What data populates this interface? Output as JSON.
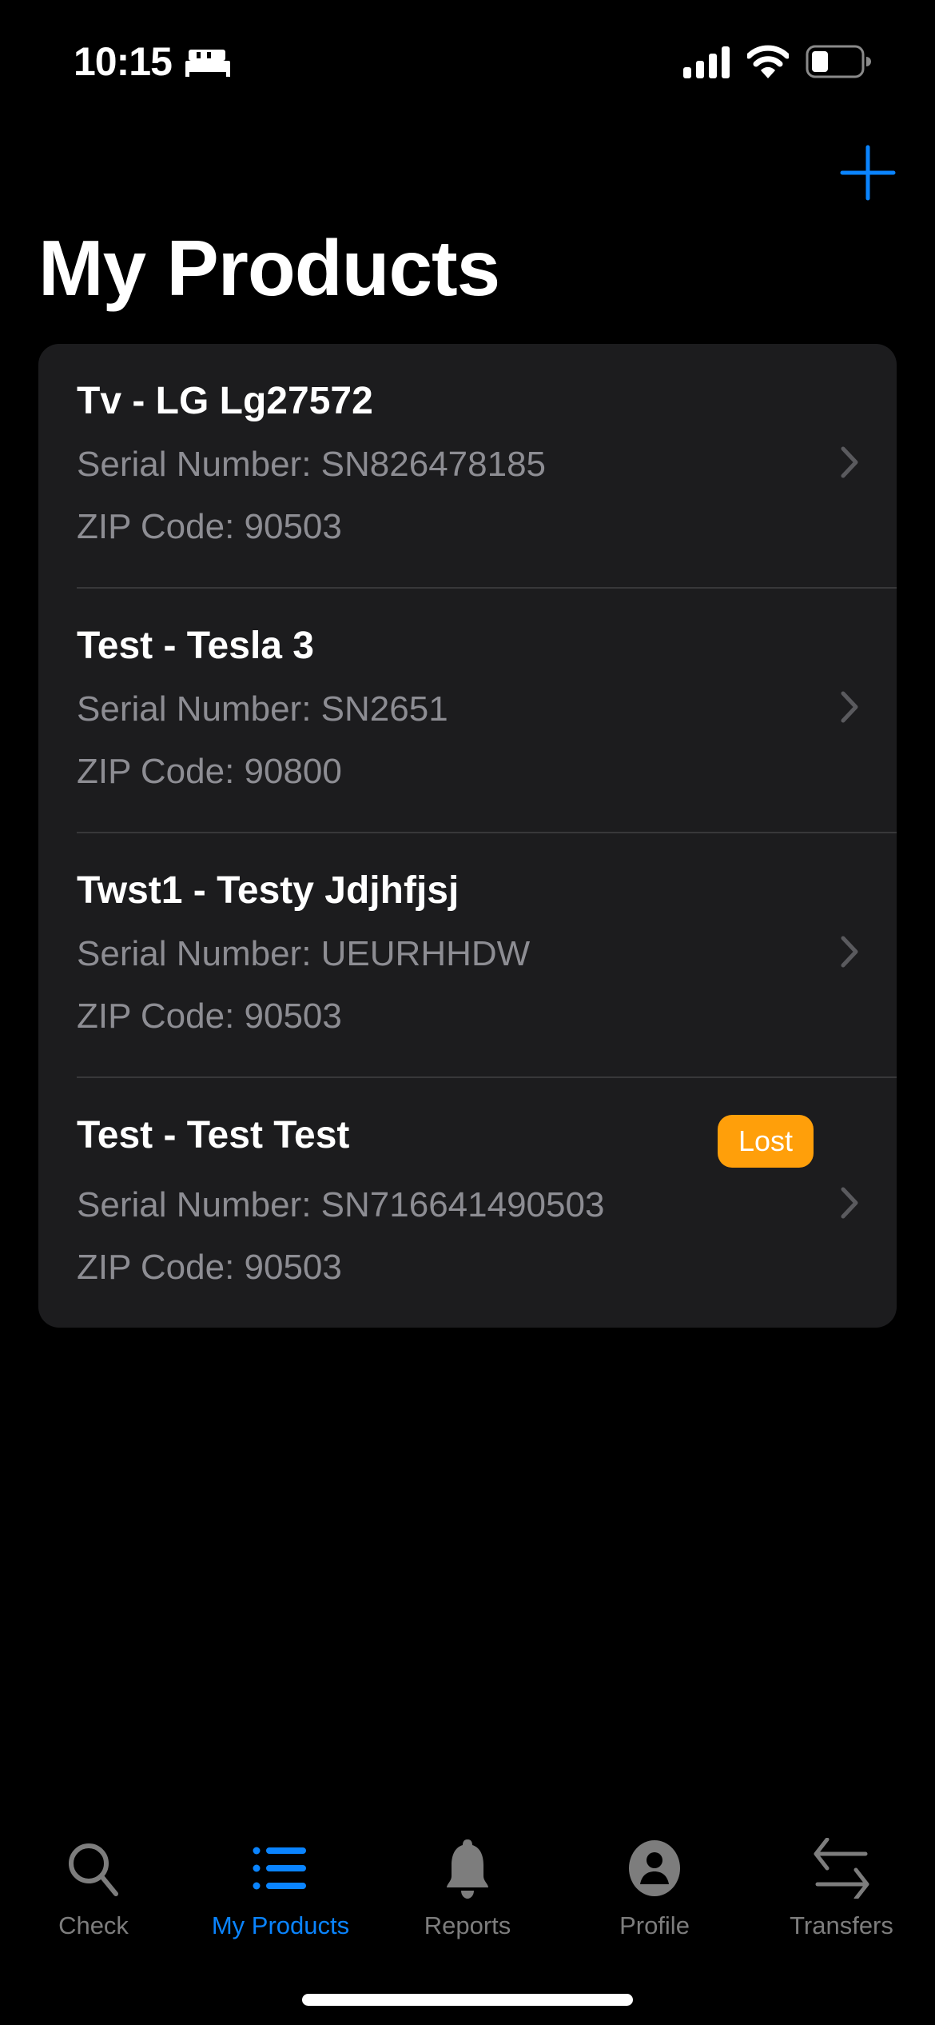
{
  "status_bar": {
    "time": "10:15",
    "focus_icon": "bed-icon",
    "signal_icon": "cellular-signal-icon",
    "wifi_icon": "wifi-icon",
    "battery_icon": "battery-icon"
  },
  "header": {
    "title": "My Products",
    "add_icon": "plus-icon"
  },
  "products": [
    {
      "name": "Tv - LG Lg27572",
      "serial": "Serial Number: SN826478185",
      "zip": "ZIP Code: 90503",
      "badge": null
    },
    {
      "name": "Test - Tesla 3",
      "serial": "Serial Number: SN2651",
      "zip": "ZIP Code: 90800",
      "badge": null
    },
    {
      "name": "Twst1 - Testy Jdjhfjsj",
      "serial": "Serial Number: UEURHHDW",
      "zip": "ZIP Code: 90503",
      "badge": null
    },
    {
      "name": "Test - Test Test",
      "serial": "Serial Number: SN716641490503",
      "zip": "ZIP Code: 90503",
      "badge": "Lost"
    }
  ],
  "tab_bar": {
    "tabs": [
      {
        "label": "Check",
        "icon": "magnifying-glass-icon",
        "active": false
      },
      {
        "label": "My Products",
        "icon": "list-icon",
        "active": true
      },
      {
        "label": "Reports",
        "icon": "bell-icon",
        "active": false
      },
      {
        "label": "Profile",
        "icon": "person-circle-icon",
        "active": false
      },
      {
        "label": "Transfers",
        "icon": "arrows-left-right-icon",
        "active": false
      }
    ]
  },
  "colors": {
    "accent": "#0a84ff",
    "badge_lost": "#ff9f0a",
    "card_background": "#1c1c1e",
    "secondary_text": "#8d8d93",
    "inactive_tab": "#7d7d7d"
  }
}
